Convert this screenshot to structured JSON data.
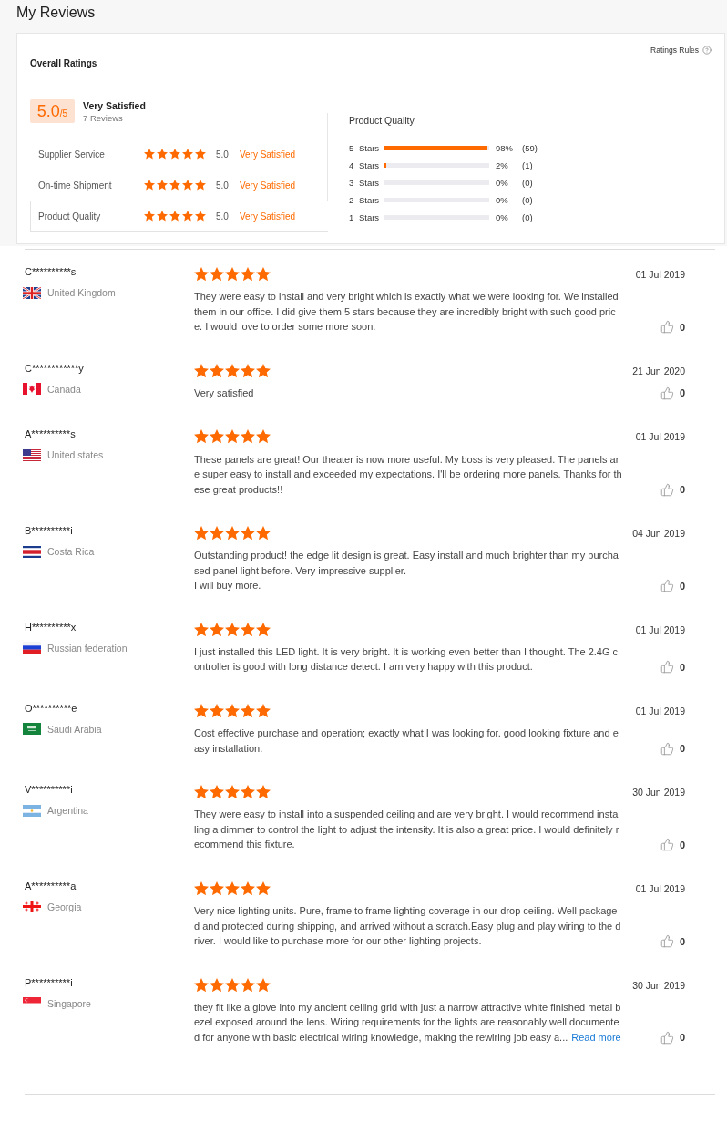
{
  "page": {
    "title": "My Reviews"
  },
  "overall": {
    "title": "Overall Ratings",
    "rules_link": "Ratings Rules",
    "score": "5.0",
    "scale": "/5",
    "verdict": "Very Satisfied",
    "review_count": "7 Reviews",
    "rows": [
      {
        "label": "Supplier Service",
        "stars": 5,
        "score": "5.0",
        "verdict": "Very Satisfied",
        "selected": false
      },
      {
        "label": "On-time Shipment",
        "stars": 5,
        "score": "5.0",
        "verdict": "Very Satisfied",
        "selected": false
      },
      {
        "label": "Product Quality",
        "stars": 5,
        "score": "5.0",
        "verdict": "Very Satisfied",
        "selected": true
      }
    ]
  },
  "histogram": {
    "title": "Product Quality",
    "rows": [
      {
        "label": "5 Stars",
        "level": 0.98,
        "percent": "98%",
        "count": "(59)"
      },
      {
        "label": "4 Stars",
        "level": 0.02,
        "percent": "2%",
        "count": "(1)"
      },
      {
        "label": "3 Stars",
        "level": 0,
        "percent": "0%",
        "count": "(0)"
      },
      {
        "label": "2 Stars",
        "level": 0,
        "percent": "0%",
        "count": "(0)"
      },
      {
        "label": "1 Stars",
        "level": 0,
        "percent": "0%",
        "count": "(0)"
      }
    ]
  },
  "reviews": [
    {
      "name": "C**********s",
      "kind": "gb",
      "country": "United Kingdom",
      "stars": 5,
      "text": "They were easy to install and very bright which is exactly what we were looking for. We installed them in our office. I did give them 5 stars because they are incredibly bright with such good price. I would love to order some more soon.",
      "date": "01 Jul 2019",
      "likes": "0"
    },
    {
      "name": "C************y",
      "kind": "ca",
      "country": "Canada",
      "stars": 5,
      "text": "Very satisfied",
      "date": "21 Jun 2020",
      "likes": "0"
    },
    {
      "name": "A**********s",
      "kind": "us",
      "country": "United states",
      "stars": 5,
      "text": "These panels are great! Our theater is now more useful. My boss is very pleased. The panels are super easy to install and exceeded my expectations. I'll be ordering more panels. Thanks for these great products!!",
      "date": "01 Jul 2019",
      "likes": "0"
    },
    {
      "name": "B**********i",
      "kind": "cr",
      "country": "Costa Rica",
      "stars": 5,
      "text": "Outstanding product! the edge lit design is great. Easy install and much brighter than my purchased panel light before. Very impressive supplier.\nI will buy more.",
      "date": "04 Jun 2019",
      "likes": "0"
    },
    {
      "name": "H**********x",
      "kind": "ru",
      "country": "Russian federation",
      "stars": 5,
      "text": "I just installed this LED light. It is very bright. It is working even better than I thought. The 2.4G controller is good with long distance detect. I am very happy with this product.",
      "date": "01 Jul 2019",
      "likes": "0"
    },
    {
      "name": "O**********e",
      "kind": "sa",
      "country": "Saudi Arabia",
      "stars": 5,
      "text": "Cost effective purchase and operation; exactly what I was looking for. good looking fixture and easy installation.",
      "date": "01 Jul 2019",
      "likes": "0"
    },
    {
      "name": "V**********i",
      "kind": "ar",
      "country": "Argentina",
      "stars": 5,
      "text": "They were easy to install into a suspended ceiling and are very bright. I would recommend installing a dimmer to control the light to adjust the intensity. It is also a great price. I would definitely recommend this fixture.",
      "date": "30 Jun 2019",
      "likes": "0"
    },
    {
      "name": "A**********a",
      "kind": "ge",
      "country": "Georgia",
      "stars": 5,
      "text": "Very nice lighting units. Pure, frame to frame lighting coverage in our drop ceiling. Well packaged and protected during shipping, and arrived without a scratch.Easy plug and play wiring to the driver. I would like to purchase more for our other lighting projects.",
      "date": "01 Jul 2019",
      "likes": "0"
    },
    {
      "name": "P**********i",
      "kind": "sg",
      "country": "Singapore",
      "stars": 5,
      "text": "they fit like a glove into my ancient ceiling grid with just a narrow attractive white finished metal bezel exposed around the lens. Wiring requirements for the lights are reasonably well documented for anyone with basic electrical wiring knowledge, making the rewiring job easy a...",
      "read_more": "Read more",
      "date": "30 Jun 2019",
      "likes": "0"
    }
  ]
}
